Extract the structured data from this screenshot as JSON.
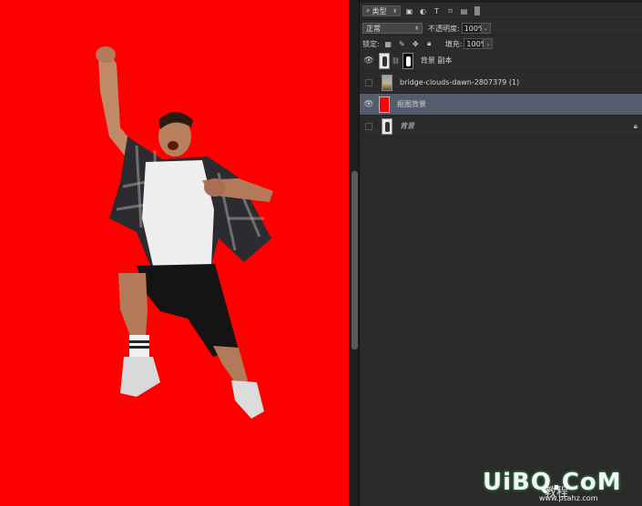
{
  "layers_toolbar": {
    "filter_kind": "类型",
    "blend_mode": "正常",
    "opacity_label": "不透明度:",
    "opacity_value": "100%",
    "lock_label": "锁定:",
    "fill_label": "填充:",
    "fill_value": "100%"
  },
  "layers": [
    {
      "name": "背景 副本",
      "visible": true,
      "has_mask": true
    },
    {
      "name": "bridge-clouds-dawn-2807379 (1)",
      "visible": false
    },
    {
      "name": "抠图背景",
      "visible": true,
      "selected": true,
      "fill_color": "#ff0000"
    },
    {
      "name": "背景",
      "visible": false,
      "locked": true
    }
  ],
  "canvas": {
    "background_color": "#ff0000"
  },
  "watermark": {
    "text": "UiBQ.CoM",
    "sub": "教程",
    "url": "www.psahz.com"
  }
}
